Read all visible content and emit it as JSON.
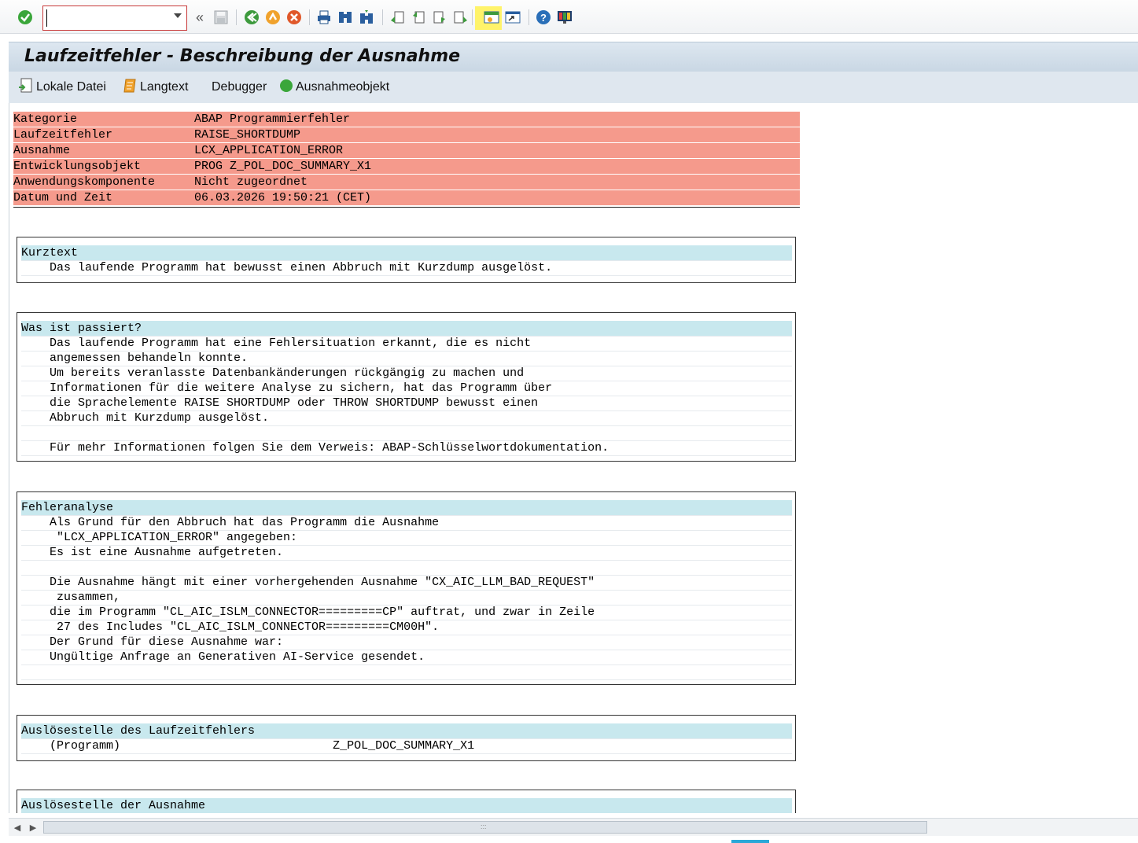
{
  "toolbar": {
    "command_value": "",
    "icons": [
      "check-icon",
      "back-double-icon",
      "save-icon",
      "back-icon",
      "exit-icon",
      "cancel-icon",
      "print-icon",
      "find-icon",
      "find-next-icon",
      "first-page-icon",
      "prev-page-icon",
      "next-page-icon",
      "last-page-icon",
      "new-session-icon",
      "shortcut-icon",
      "help-icon",
      "layout-icon"
    ]
  },
  "title": "Laufzeitfehler - Beschreibung der Ausnahme",
  "app_toolbar": {
    "local_file": "Lokale Datei",
    "long_text": "Langtext",
    "debugger": "Debugger",
    "exception_object": "Ausnahmeobjekt"
  },
  "header": [
    {
      "key": "Kategorie",
      "value": "ABAP Programmierfehler"
    },
    {
      "key": "Laufzeitfehler",
      "value": "RAISE_SHORTDUMP"
    },
    {
      "key": "Ausnahme",
      "value": "LCX_APPLICATION_ERROR"
    },
    {
      "key": "Entwicklungsobjekt",
      "value": "PROG Z_POL_DOC_SUMMARY_X1"
    },
    {
      "key": "Anwendungskomponente",
      "value": "Nicht zugeordnet"
    },
    {
      "key": "Datum und Zeit",
      "value": "06.03.2026 19:50:21 (CET)"
    }
  ],
  "sections": {
    "kurztext": {
      "title": "Kurztext",
      "lines": [
        "    Das laufende Programm hat bewusst einen Abbruch mit Kurzdump ausgelöst."
      ]
    },
    "passiert": {
      "title": "Was ist passiert?",
      "lines": [
        "    Das laufende Programm hat eine Fehlersituation erkannt, die es nicht",
        "    angemessen behandeln konnte.",
        "    Um bereits veranlasste Datenbankänderungen rückgängig zu machen und",
        "    Informationen für die weitere Analyse zu sichern, hat das Programm über",
        "    die Sprachelemente RAISE SHORTDUMP oder THROW SHORTDUMP bewusst einen",
        "    Abbruch mit Kurzdump ausgelöst.",
        "",
        "    Für mehr Informationen folgen Sie dem Verweis: ABAP-Schlüsselwortdokumentation."
      ]
    },
    "fehleranalyse": {
      "title": "Fehleranalyse",
      "lines": [
        "    Als Grund für den Abbruch hat das Programm die Ausnahme",
        "     \"LCX_APPLICATION_ERROR\" angegeben:",
        "    Es ist eine Ausnahme aufgetreten.",
        "",
        "    Die Ausnahme hängt mit einer vorhergehenden Ausnahme \"CX_AIC_LLM_BAD_REQUEST\"",
        "     zusammen,",
        "    die im Programm \"CL_AIC_ISLM_CONNECTOR=========CP\" auftrat, und zwar in Zeile",
        "     27 des Includes \"CL_AIC_ISLM_CONNECTOR=========CM00H\".",
        "    Der Grund für diese Ausnahme war:",
        "    Ungültige Anfrage an Generativen AI-Service gesendet.",
        ""
      ]
    },
    "ausloesestelle_lf": {
      "title": "Auslösestelle des Laufzeitfehlers",
      "lines": [
        "    (Programm)                              Z_POL_DOC_SUMMARY_X1"
      ]
    },
    "ausloesestelle_ausnahme": {
      "title": "Auslösestelle der Ausnahme",
      "lines": []
    }
  },
  "colors": {
    "header_bg": "#f59a8c",
    "section_title_bg": "#c8e8ee",
    "highlight": "#fff36a"
  }
}
